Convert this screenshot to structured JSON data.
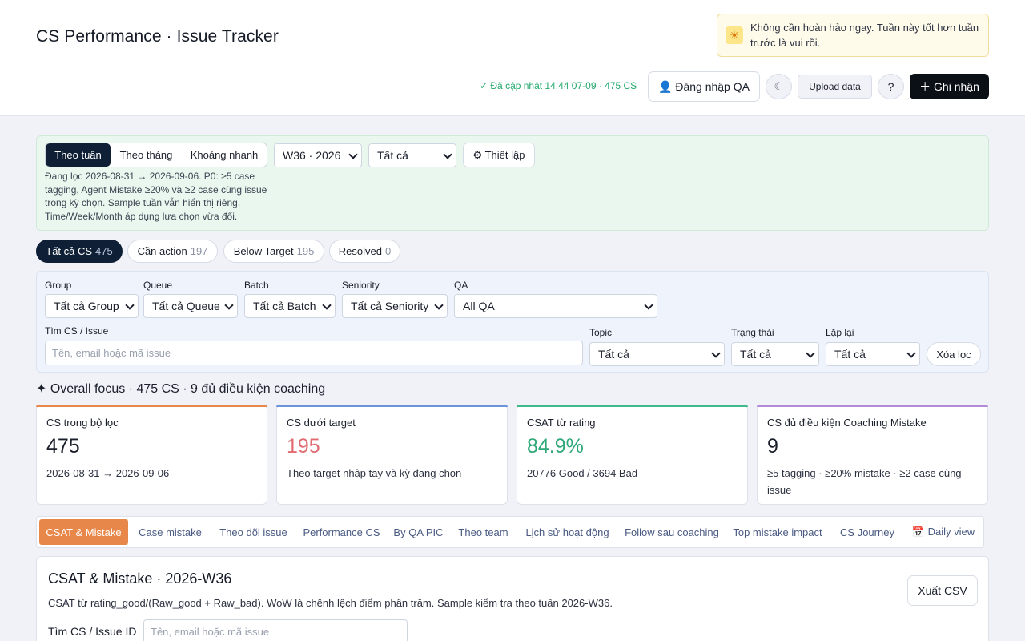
{
  "header": {
    "title": "CS Performance · Issue Tracker",
    "motivation": "Không cần hoàn hảo ngay. Tuần này tốt hơn tuần trước là vui rồi.",
    "updated": "✓ Đã cập nhật 14:44 07-09 · 475 CS",
    "login_label": "👤 Đăng nhập QA",
    "theme_icon": "☾",
    "upload_label": "Upload data",
    "help_label": "?",
    "record_label": "＋ Ghi nhận",
    "sun_icon": "☀"
  },
  "period": {
    "modes": [
      "Theo tuần",
      "Theo tháng",
      "Khoảng nhanh"
    ],
    "active_mode": "Theo tuần",
    "week_select": "W36 · 2026",
    "scope_select": "Tất cả",
    "setup_label": "⚙ Thiết lập",
    "note": "Đang lọc 2026-08-31 → 2026-09-06. P0: ≥5 case tagging, Agent Mistake ≥20% và ≥2 case cùng issue trong kỳ chọn. Sample tuần vẫn hiển thị riêng. Time/Week/Month áp dụng lựa chọn vừa đổi."
  },
  "status_pills": [
    {
      "label": "Tất cả CS",
      "count": "475",
      "active": true
    },
    {
      "label": "Cần action",
      "count": "197",
      "active": false
    },
    {
      "label": "Below Target",
      "count": "195",
      "active": false
    },
    {
      "label": "Resolved",
      "count": "0",
      "active": false
    }
  ],
  "filters": {
    "group_label": "Group",
    "group_value": "Tất cả Group",
    "queue_label": "Queue",
    "queue_value": "Tất cả Queue",
    "batch_label": "Batch",
    "batch_value": "Tất cả Batch",
    "seniority_label": "Seniority",
    "seniority_value": "Tất cả Seniority",
    "qa_label": "QA",
    "qa_value": "All QA",
    "search_label": "Tìm CS / Issue",
    "search_placeholder": "Tên, email hoặc mã issue",
    "topic_label": "Topic",
    "topic_value": "Tất cả",
    "status_label": "Trạng thái",
    "status_value": "Tất cả",
    "repeat_label": "Lặp lại",
    "repeat_value": "Tất cả",
    "clear_label": "Xóa lọc"
  },
  "focus": {
    "title": "✦ Overall focus · 475 CS · 9 đủ điều kiện coaching"
  },
  "cards": [
    {
      "title": "CS trong bộ lọc",
      "value": "475",
      "sub": "2026-08-31 → 2026-09-06",
      "accent": "#e8874a",
      "value_color": "#1a1f2b"
    },
    {
      "title": "CS dưới target",
      "value": "195",
      "sub": "Theo target nhập tay và kỳ đang chọn",
      "accent": "#6b93d6",
      "value_color": "#e06c72"
    },
    {
      "title": "CSAT từ rating",
      "value": "84.9%",
      "sub": "20776 Good / 3694 Bad",
      "accent": "#3fb88a",
      "value_color": "#2fa878"
    },
    {
      "title": "CS đủ điều kiện Coaching Mistake",
      "value": "9",
      "sub": "≥5 tagging · ≥20% mistake · ≥2 case cùng issue",
      "accent": "#b48ad6",
      "value_color": "#1a1f2b"
    }
  ],
  "tabs": [
    "CSAT & Mistake",
    "Case mistake",
    "Theo dõi issue",
    "Performance CS",
    "By QA PIC",
    "Theo team",
    "Lịch sử hoạt động",
    "Follow sau coaching",
    "Top mistake impact",
    "CS Journey",
    "📅 Daily view"
  ],
  "active_tab": "CSAT & Mistake",
  "section": {
    "title": "CSAT & Mistake · 2026-W36",
    "desc": "CSAT từ rating_good/(Raw_good + Raw_bad). WoW là chênh lệch điểm phần trăm. Sample kiểm tra theo tuần 2026-W36.",
    "export_label": "Xuất CSV",
    "search_label": "Tìm CS / Issue ID",
    "search_placeholder": "Tên, email hoặc mã issue"
  }
}
